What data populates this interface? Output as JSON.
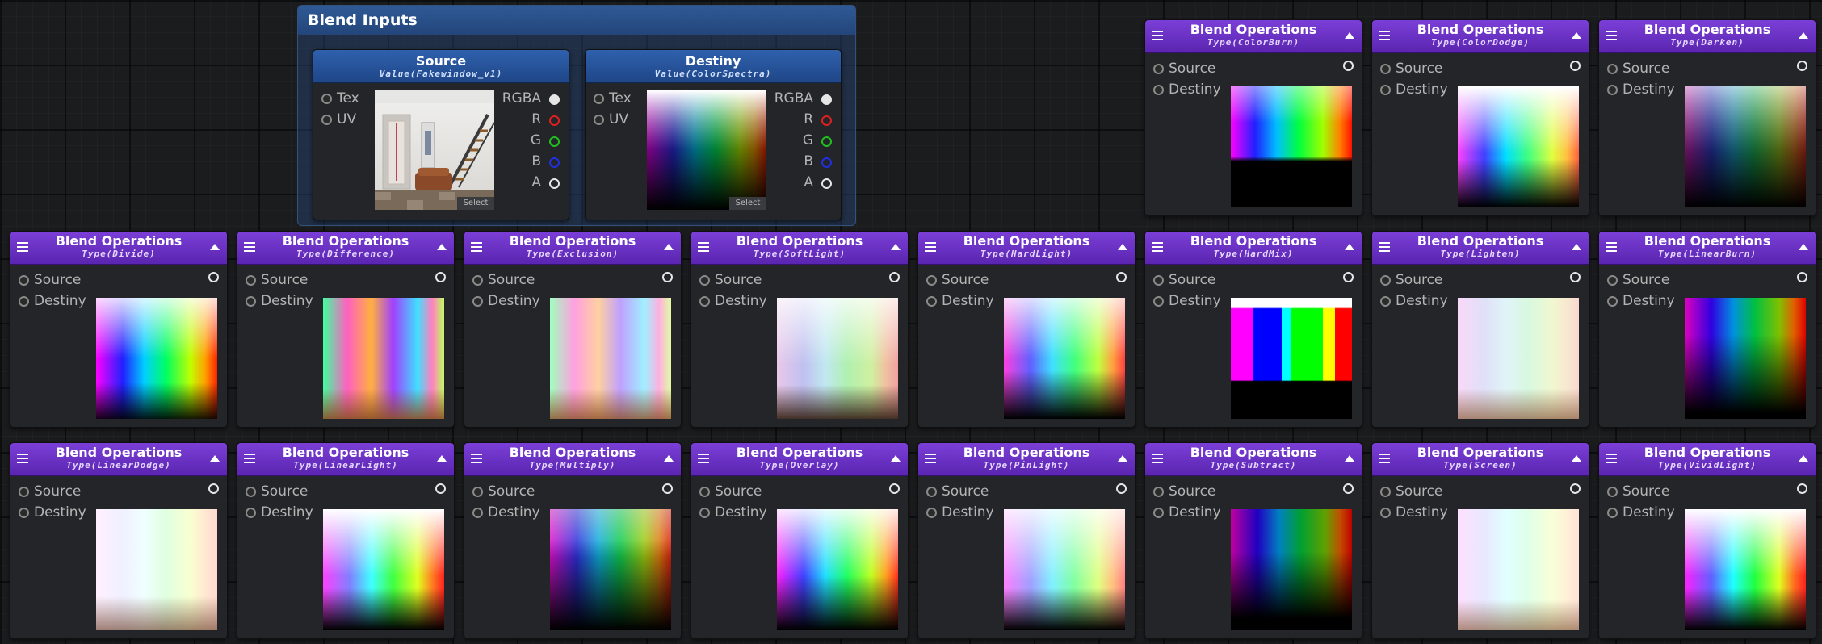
{
  "group": {
    "title": "Blend Inputs"
  },
  "source_node": {
    "title": "Source",
    "subtitle": "Value(Fakewindow_v1)",
    "inputs": [
      "Tex",
      "UV"
    ],
    "outputs": [
      "RGBA",
      "R",
      "G",
      "B",
      "A"
    ],
    "select_label": "Select"
  },
  "destiny_node": {
    "title": "Destiny",
    "subtitle": "Value(ColorSpectra)",
    "inputs": [
      "Tex",
      "UV"
    ],
    "outputs": [
      "RGBA",
      "R",
      "G",
      "B",
      "A"
    ],
    "select_label": "Select"
  },
  "blend_node_title": "Blend Operations",
  "port_source": "Source",
  "port_destiny": "Destiny",
  "blend_nodes": [
    {
      "subtitle": "Type(ColorBurn)"
    },
    {
      "subtitle": "Type(ColorDodge)"
    },
    {
      "subtitle": "Type(Darken)"
    },
    {
      "subtitle": "Type(Divide)"
    },
    {
      "subtitle": "Type(Difference)"
    },
    {
      "subtitle": "Type(Exclusion)"
    },
    {
      "subtitle": "Type(SoftLight)"
    },
    {
      "subtitle": "Type(HardLight)"
    },
    {
      "subtitle": "Type(HardMix)"
    },
    {
      "subtitle": "Type(Lighten)"
    },
    {
      "subtitle": "Type(LinearBurn)"
    },
    {
      "subtitle": "Type(LinearDodge)"
    },
    {
      "subtitle": "Type(LinearLight)"
    },
    {
      "subtitle": "Type(Multiply)"
    },
    {
      "subtitle": "Type(Overlay)"
    },
    {
      "subtitle": "Type(PinLight)"
    },
    {
      "subtitle": "Type(Subtract)"
    },
    {
      "subtitle": "Type(Screen)"
    },
    {
      "subtitle": "Type(VividLight)"
    }
  ],
  "colors": {
    "group_header": "#2a5290",
    "input_header": "#2856a0",
    "blend_header": "#6a30c8",
    "port_r": "#e02020",
    "port_g": "#20c020",
    "port_b": "#2030e0",
    "port_white": "#e6e6e6"
  }
}
